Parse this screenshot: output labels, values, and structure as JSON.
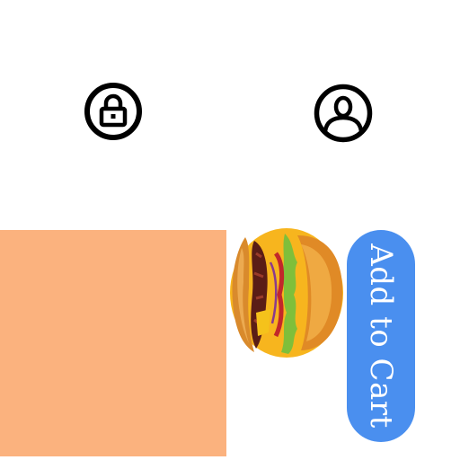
{
  "icons": {
    "lock": "lock-icon",
    "profile": "user-profile-icon",
    "product": "burger-image"
  },
  "swatch": {
    "color": "#fbb27e"
  },
  "cart_button": {
    "label": "Add to Cart",
    "color": "#4a8fef"
  }
}
